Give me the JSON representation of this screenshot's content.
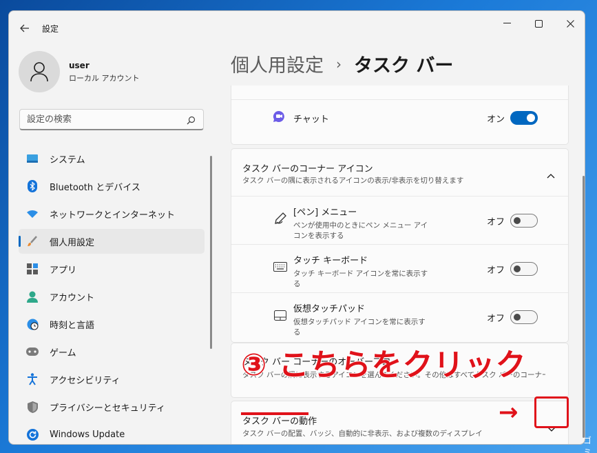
{
  "window": {
    "title": "設定"
  },
  "profile": {
    "name": "user",
    "account_type": "ローカル アカウント"
  },
  "search": {
    "placeholder": "設定の検索"
  },
  "nav": {
    "items": [
      {
        "label": "システム"
      },
      {
        "label": "Bluetooth とデバイス"
      },
      {
        "label": "ネットワークとインターネット"
      },
      {
        "label": "個人用設定"
      },
      {
        "label": "アプリ"
      },
      {
        "label": "アカウント"
      },
      {
        "label": "時刻と言語"
      },
      {
        "label": "ゲーム"
      },
      {
        "label": "アクセシビリティ"
      },
      {
        "label": "プライバシーとセキュリティ"
      },
      {
        "label": "Windows Update"
      }
    ],
    "active_index": 3
  },
  "breadcrumb": {
    "parent": "個人用設定",
    "separator": "›",
    "current": "タスク バー"
  },
  "chat": {
    "label": "チャット",
    "state": "オン",
    "on": true
  },
  "corner_icons": {
    "title": "タスク バーのコーナー アイコン",
    "desc": "タスク バーの隅に表示されるアイコンの表示/非表示を切り替えます",
    "items": [
      {
        "title": "[ペン] メニュー",
        "desc": "ペンが使用中のときにペン メニュー アイコンを表示する",
        "state": "オフ",
        "icon": "pen-icon"
      },
      {
        "title": "タッチ キーボード",
        "desc": "タッチ キーボード アイコンを常に表示する",
        "state": "オフ",
        "icon": "keyboard-icon"
      },
      {
        "title": "仮想タッチパッド",
        "desc": "仮想タッチパッド アイコンを常に表示する",
        "state": "オフ",
        "icon": "touchpad-icon"
      }
    ]
  },
  "overflow": {
    "title": "タスク バー コーナーのオーバーフロー",
    "desc": "タスク バーの隅に表示するアイコンを選んでください。その他はすべてタスク バーのコーナー オーバーフロー メニューに表示されます"
  },
  "behavior": {
    "title": "タスク バーの動作",
    "desc": "タスク バーの配置、バッジ、自動的に非表示、および複数のディスプレイ"
  },
  "annotation": {
    "text": "③ こちらをクリック",
    "arrow": "→"
  },
  "desktop": {
    "label": "ゴミ箱"
  },
  "colors": {
    "accent": "#0067c0",
    "annotation": "#e0121a"
  }
}
